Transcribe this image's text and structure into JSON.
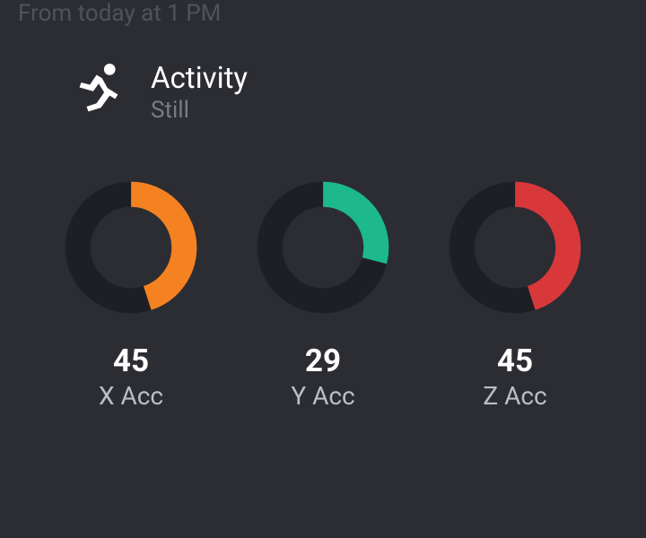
{
  "header": {
    "faded_text": "From today at 1 PM"
  },
  "activity": {
    "title": "Activity",
    "status": "Still"
  },
  "gauges": [
    {
      "value": "45",
      "label": "X Acc",
      "percent": 45,
      "color": "#f58220"
    },
    {
      "value": "29",
      "label": "Y Acc",
      "percent": 29,
      "color": "#1db98a"
    },
    {
      "value": "45",
      "label": "Z Acc",
      "percent": 45,
      "color": "#d8383a"
    }
  ],
  "chart_data": [
    {
      "type": "pie",
      "title": "X Acc",
      "data": {
        "filled": 45,
        "remaining": 55
      },
      "color": "#f58220",
      "max": 100
    },
    {
      "type": "pie",
      "title": "Y Acc",
      "data": {
        "filled": 29,
        "remaining": 71
      },
      "color": "#1db98a",
      "max": 100
    },
    {
      "type": "pie",
      "title": "Z Acc",
      "data": {
        "filled": 45,
        "remaining": 55
      },
      "color": "#d8383a",
      "max": 100
    }
  ]
}
